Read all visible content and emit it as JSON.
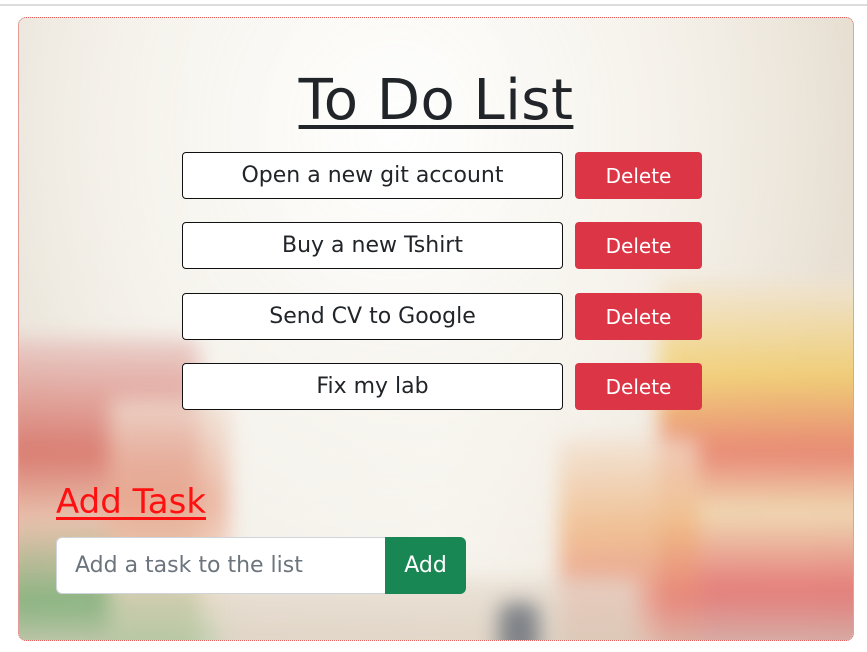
{
  "title": "To Do List",
  "tasks": [
    {
      "text": "Open a new git account",
      "delete_label": "Delete"
    },
    {
      "text": "Buy a new Tshirt",
      "delete_label": "Delete"
    },
    {
      "text": "Send CV to Google",
      "delete_label": "Delete"
    },
    {
      "text": "Fix my lab",
      "delete_label": "Delete"
    }
  ],
  "add_section": {
    "title": "Add Task",
    "input_placeholder": "Add a task to the list",
    "input_value": "",
    "button_label": "Add"
  },
  "colors": {
    "delete": "#dc3545",
    "add": "#198754",
    "add_title": "#ff1010",
    "card_border": "#e35a5a"
  }
}
